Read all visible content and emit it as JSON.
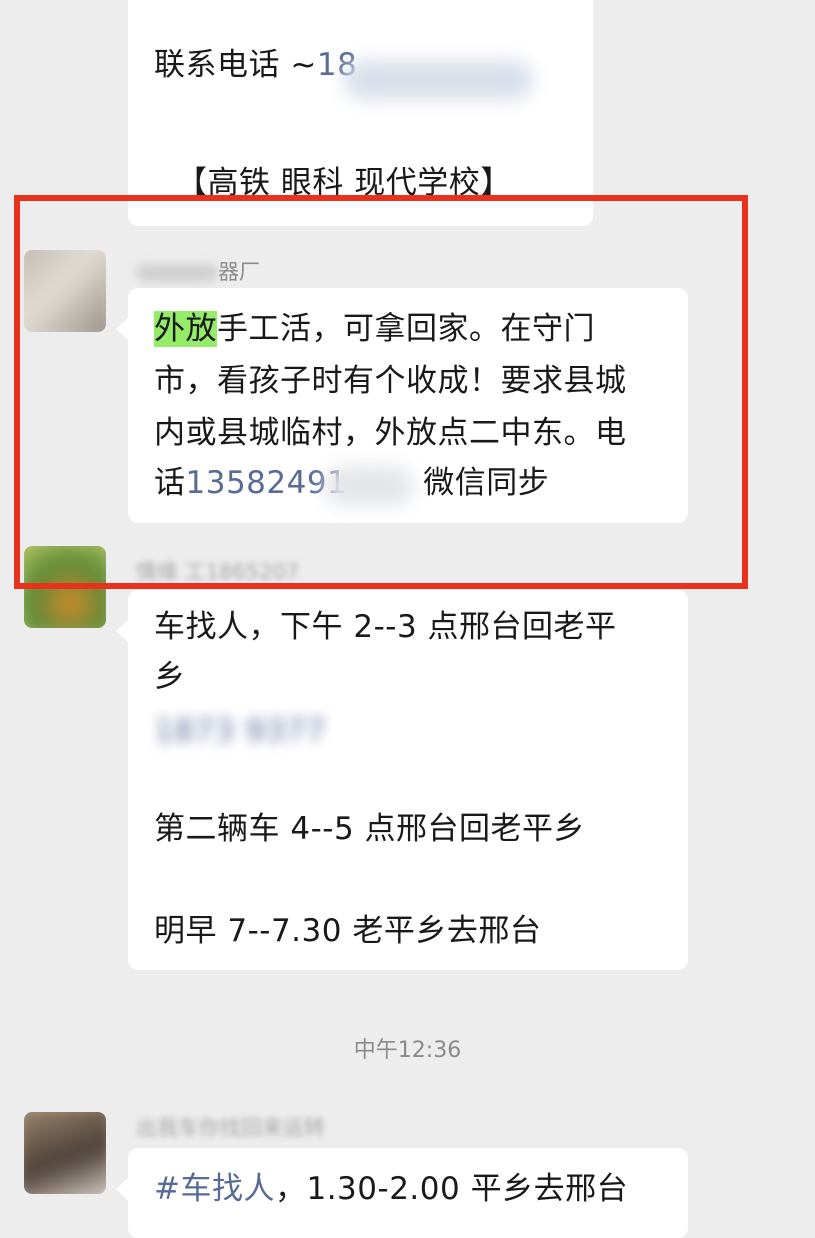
{
  "messages": [
    {
      "lines": [
        {
          "prefix": "联系电话 ~",
          "phone": "18"
        },
        {
          "text": "【高铁  眼科  现代学校】"
        }
      ]
    },
    {
      "sender_suffix": "器厂",
      "highlight": "外放",
      "lines": [
        "手工活，可拿回家。在守门",
        "市，看孩子时有个收成！要求县城",
        "内或县城临村，外放点二中东。电"
      ],
      "last_line": {
        "prefix": "话",
        "phone": "13582491",
        "suffix": "微信同步"
      }
    },
    {
      "sender_partial": "情缘 工1865207",
      "lines": [
        "车找人，下午 2--3 点邢台回老平",
        "乡"
      ],
      "phone_partial": "1873   9377",
      "extra_lines": [
        "第二辆车 4--5 点邢台回老平乡",
        "明早 7--7.30 老平乡去邢台"
      ]
    },
    {
      "sender_partial": "出我车你找回来运转",
      "first_line": "#车找人，1.30-2.00 平乡去邢台"
    }
  ],
  "timestamp": "中午12:36",
  "colors": {
    "background": "#ededed",
    "bubble": "#ffffff",
    "link_blue": "#576b95",
    "highlight_green": "#95ec69",
    "annotation_red": "#e8321e"
  }
}
